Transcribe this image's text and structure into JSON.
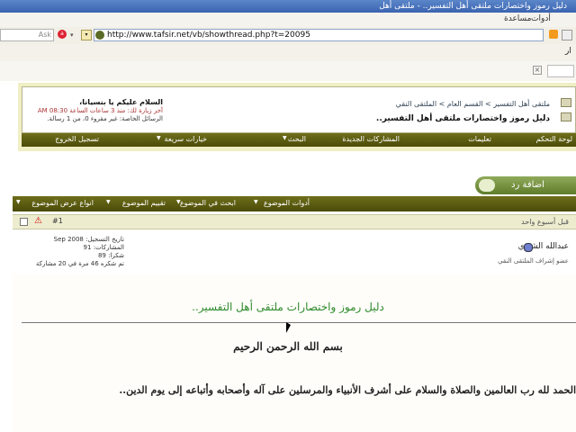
{
  "window": {
    "title": "دليل رموز واختصارات ملتقى أهل التفسير.. - ملتقى أهل"
  },
  "menubar": {
    "tools": "أدوات",
    "help": "مساعدة"
  },
  "search": {
    "ask_placeholder": "Ask"
  },
  "address": {
    "url": "http://www.tafsir.net/vb/showthread.php?t=20095"
  },
  "toolbar3": {
    "text": "ار"
  },
  "header": {
    "breadcrumb": "ملتقى أهل التفسير > القسم العام > الملتقى النقي",
    "thread_title": "دليل رموز واختصارات ملتقى أهل التفسير..",
    "welcome": "السلام عليكم يا بنسيانا،",
    "last_visit": "آخر زيارة لك: منذ 3 ساعات الساعة 08:30 AM",
    "private_messages": "الرسائل الخاصة: غير مقروء 0، من 1 رسالة."
  },
  "nav": {
    "control_panel": "لوحة التحكم",
    "instructions": "تعليمات",
    "new_posts": "المشاركات الجديدة",
    "search": "البحث",
    "quick_options": "خيارات سريعة",
    "logout": "تسجيل الخروج"
  },
  "reply_button": "اضافة رد",
  "thread_tools": {
    "tools": "أدوات الموضوع",
    "search_thread": "ابحث في الموضوع",
    "rate_thread": "تقييم الموضوع",
    "display_modes": "انواع عرض الموضوع"
  },
  "post_head": {
    "date": "قبل أسبوع واحد"
  },
  "post_info": {
    "username": "عبدالله الشتوي",
    "user_title": "عضو إشراف الملتقى النقي",
    "join_date": "تاريخ التسجيل: Sep 2008",
    "posts": "المشاركات: 91",
    "thanks": "شكرا: 89",
    "thanked": "تم شكره 46 مرة في 20 مشاركة"
  },
  "post": {
    "title": "دليل رموز واختصارات ملتقى أهل التفسير..",
    "bismillah": "بسم الله الرحمن الرحيم",
    "paragraph": "الحمد لله رب العالمين والصلاة والسلام على أشرف الأنبياء والمرسلين على آله وأصحابه وأتباعه إلى يوم الدين.."
  },
  "colors": {
    "nav_bg": "#5b5b12",
    "title_green": "#2d8b2d",
    "header_bg": "#f0efc4"
  }
}
